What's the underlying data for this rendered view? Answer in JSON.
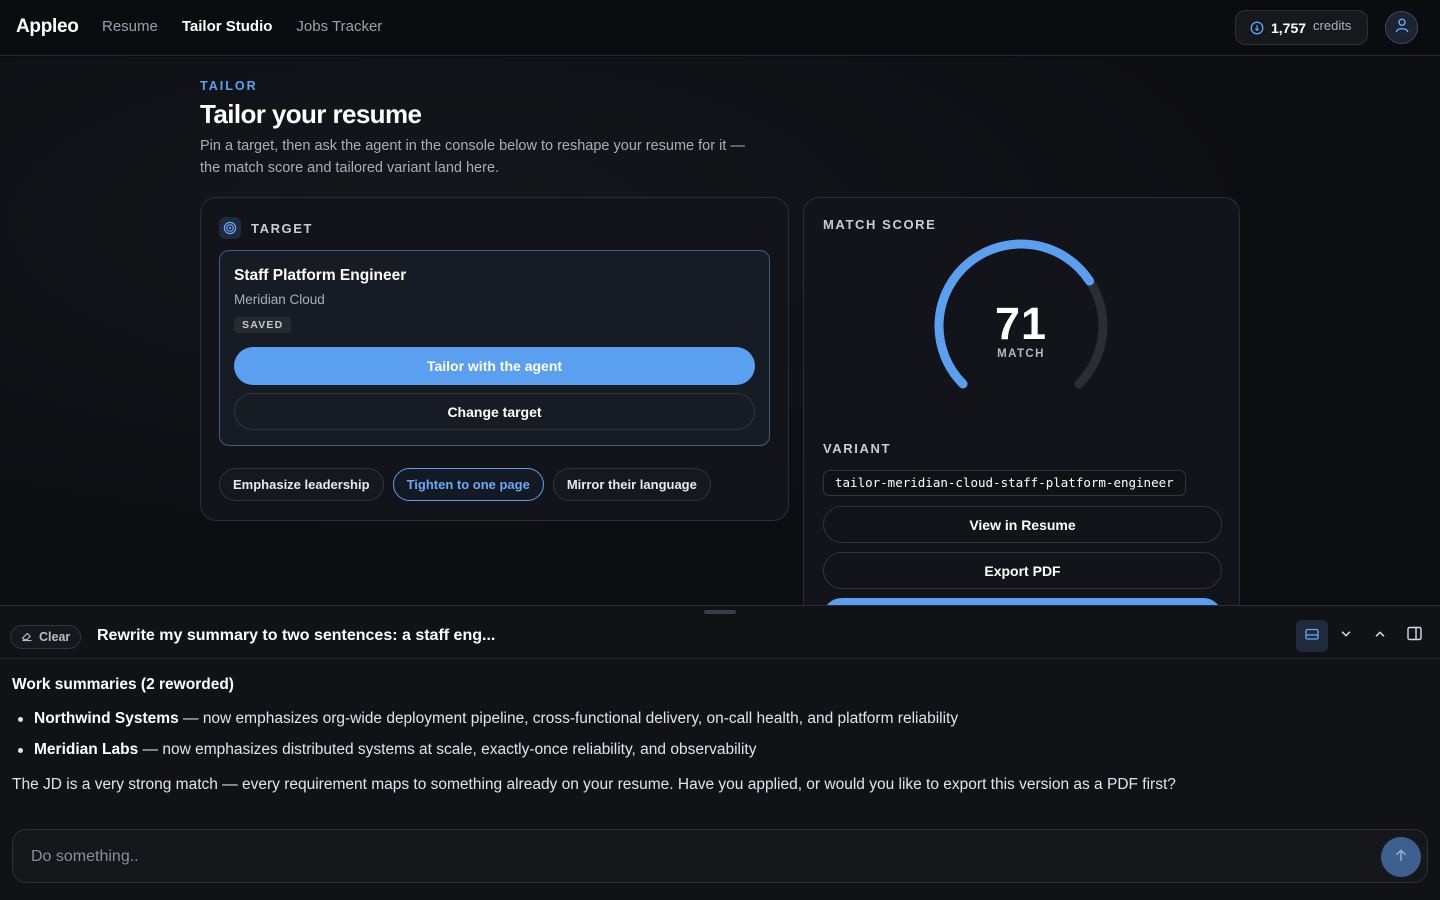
{
  "nav": {
    "brand": "Appleo",
    "links": [
      "Resume",
      "Tailor Studio",
      "Jobs Tracker"
    ],
    "active": "Tailor Studio",
    "credits_value": "1,757",
    "credits_label": "credits",
    "icons": {
      "credits": "coin-icon",
      "avatar": "user-icon"
    }
  },
  "header": {
    "eyebrow": "TAILOR",
    "title": "Tailor your resume",
    "description": "Pin a target, then ask the agent in the console below to reshape your resume for it — the match score and tailored variant land here."
  },
  "target": {
    "label": "TARGET",
    "job_title": "Staff Platform Engineer",
    "company": "Meridian Cloud",
    "status": "SAVED",
    "primary_button": "Tailor with the agent",
    "secondary_button": "Change target",
    "chips": [
      "Emphasize leadership",
      "Tighten to one page",
      "Mirror their language"
    ],
    "selected_chip": "Tighten to one page",
    "icons": {
      "section": "target-icon"
    }
  },
  "score": {
    "label": "MATCH SCORE",
    "value": 71,
    "max": 100,
    "value_label": "MATCH",
    "variant_label": "VARIANT",
    "variant_id": "tailor-meridian-cloud-staff-platform-engineer",
    "view_button": "View in Resume",
    "export_button": "Export PDF"
  },
  "console": {
    "clear_label": "Clear",
    "title": "Rewrite my summary to two sentences: a staff eng...",
    "response_heading": "Work summaries (2 reworded)",
    "items": [
      {
        "company": "Northwind Systems",
        "text": " — now emphasizes org-wide deployment pipeline, cross-functional delivery, on-call health, and platform reliability"
      },
      {
        "company": "Meridian Labs",
        "text": " — now emphasizes distributed systems at scale, exactly-once reliability, and observability"
      }
    ],
    "footer": "The JD is a very strong match — every requirement maps to something already on your resume. Have you applied, or would you like to export this version as a PDF first?",
    "input_placeholder": "Do something..",
    "icons": [
      "eraser-icon",
      "panel-bottom-icon",
      "chevron-down-icon",
      "chevron-up-icon",
      "panel-right-icon",
      "arrow-up-icon"
    ]
  },
  "colors": {
    "accent": "#5b9ff1",
    "background": "#0c0d10",
    "card": "#121419",
    "gauge_track": "#2a2d33"
  }
}
